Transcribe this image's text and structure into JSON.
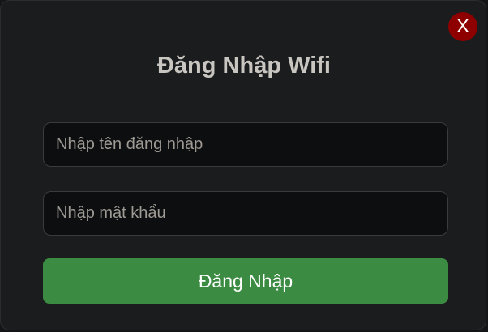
{
  "dialog": {
    "title": "Đăng Nhập Wifi",
    "close_label": "X",
    "username_field": {
      "value": "",
      "placeholder": "Nhập tên đăng nhập"
    },
    "password_field": {
      "value": "",
      "placeholder": "Nhập mật khẩu"
    },
    "submit_label": "Đăng Nhập"
  },
  "colors": {
    "background": "#1b1c1e",
    "title_text": "#c9c6c1",
    "close_button": "#8e0000",
    "submit_button": "#3b8b42",
    "field_background": "#0d0e10"
  }
}
